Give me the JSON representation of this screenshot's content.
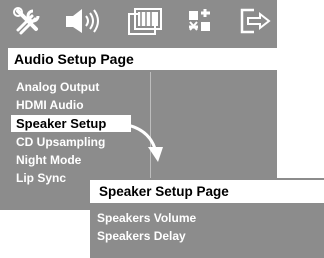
{
  "toolbar": {
    "icons": [
      "tools-icon",
      "speaker-icon",
      "video-icon",
      "preferences-icon",
      "exit-icon"
    ]
  },
  "main": {
    "title": "Audio Setup Page",
    "items": [
      {
        "label": "Analog Output",
        "selected": false
      },
      {
        "label": "HDMI Audio",
        "selected": false
      },
      {
        "label": "Speaker Setup",
        "selected": true
      },
      {
        "label": "CD Upsampling",
        "selected": false
      },
      {
        "label": "Night Mode",
        "selected": false
      },
      {
        "label": "Lip Sync",
        "selected": false
      }
    ]
  },
  "sub": {
    "title": "Speaker Setup Page",
    "items": [
      {
        "label": "Speakers Volume"
      },
      {
        "label": "Speakers Delay"
      }
    ]
  },
  "colors": {
    "panel": "#8c8c8c",
    "highlight": "#ffffff",
    "text": "#ffffff",
    "selected_text": "#000000"
  }
}
